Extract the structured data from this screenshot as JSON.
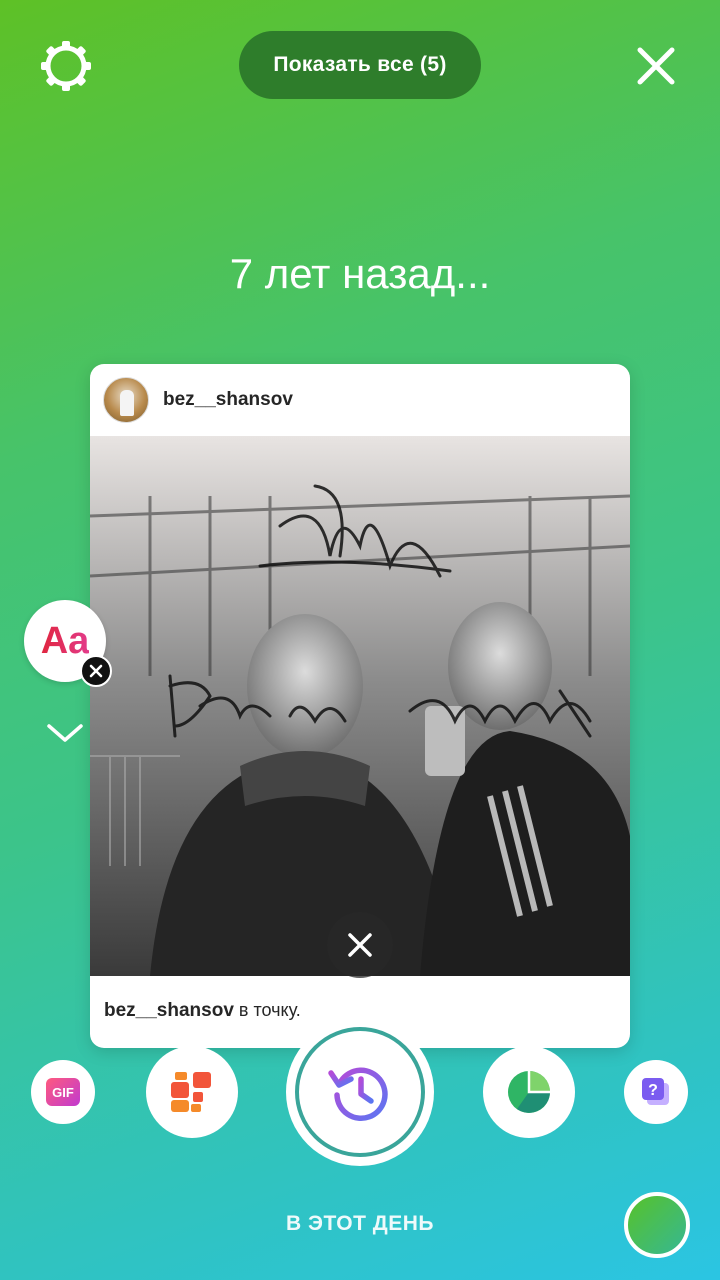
{
  "header": {
    "show_all_label": "Показать все (5)",
    "settings_icon": "gear-icon",
    "close_icon": "close-icon"
  },
  "memory": {
    "years_ago": "7 лет назад..."
  },
  "post": {
    "username": "bez__shansov",
    "caption_username": "bez__shansov",
    "caption_text": " в точку."
  },
  "stickers": {
    "text_sticker_label": "Aa"
  },
  "tools": {
    "gif_label": "GIF",
    "layout_icon": "layout-icon",
    "memories_icon": "history-icon",
    "poll_icon": "poll-pie-icon",
    "question_icon": "question-icon"
  },
  "mode": {
    "label": "В ЭТОТ ДЕНЬ"
  },
  "colors": {
    "gradient_start": "#5ec126",
    "gradient_end": "#2bc5e3",
    "show_all_bg": "#2e7d2b",
    "memories_accent": "#7b5cf0"
  }
}
